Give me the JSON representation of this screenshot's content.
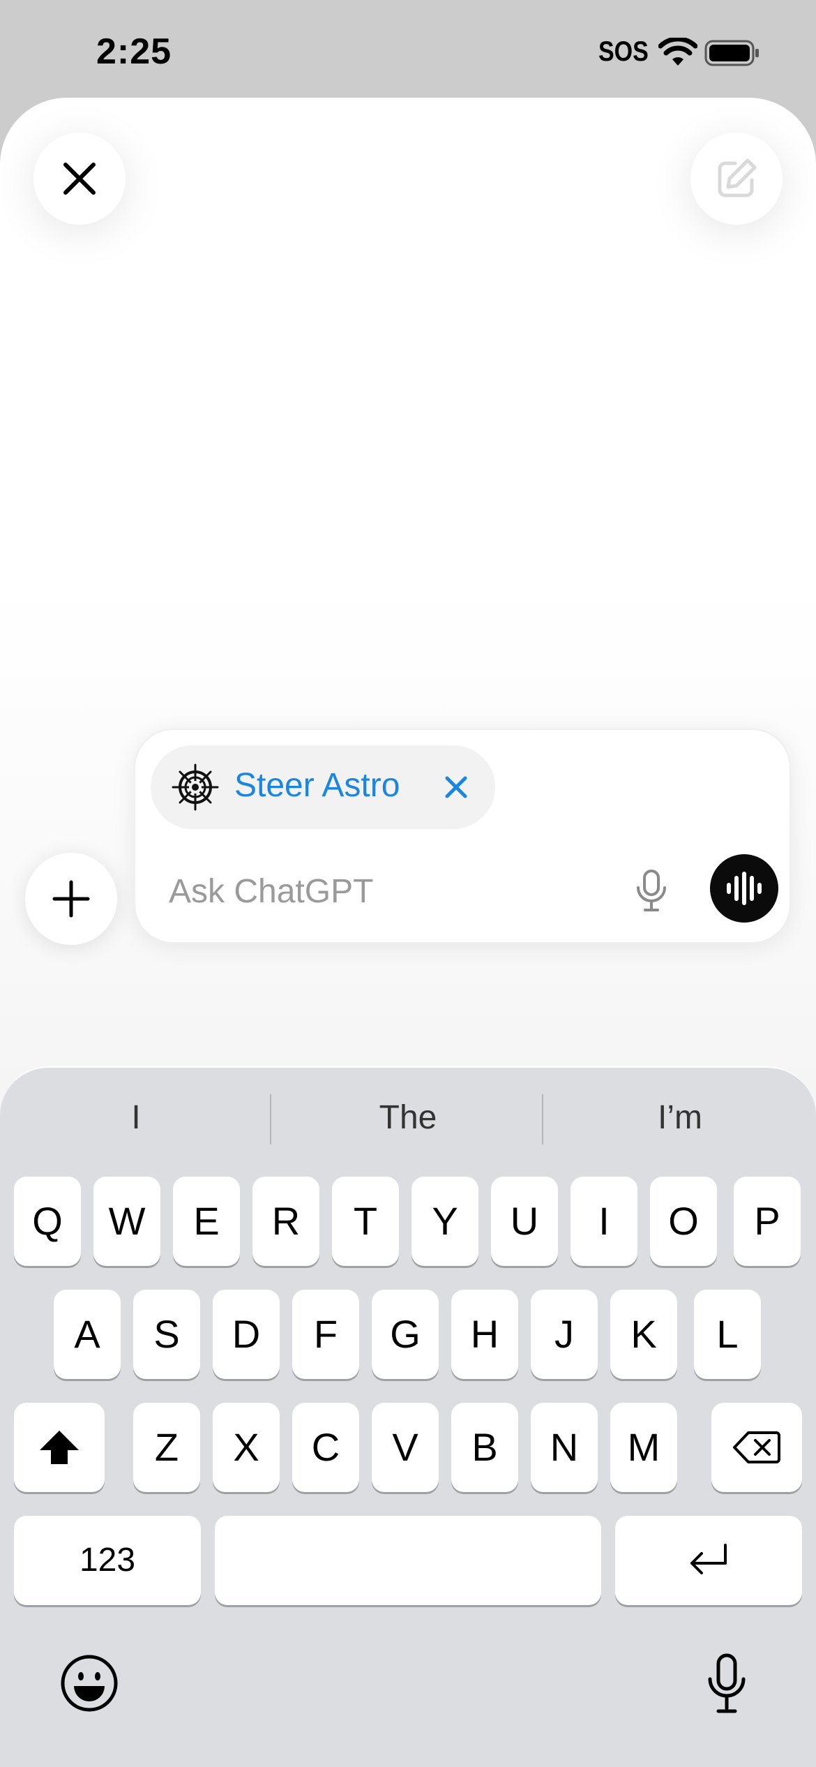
{
  "status_bar": {
    "time": "2:25",
    "sos": "SOS",
    "wifi_icon": "wifi-icon",
    "battery_icon": "battery-icon"
  },
  "header": {
    "close_icon": "close-icon",
    "compose_icon": "compose-icon"
  },
  "composer": {
    "chip": {
      "label": "Steer Astro",
      "icon": "ship-wheel-icon",
      "remove_icon": "close-icon",
      "color": "#1a86e0"
    },
    "placeholder": "Ask ChatGPT",
    "value": "",
    "mic_icon": "microphone-icon",
    "voice_icon": "voice-waveform-icon",
    "plus_icon": "plus-icon"
  },
  "keyboard": {
    "suggestions": [
      "I",
      "The",
      "I’m"
    ],
    "row1": [
      "Q",
      "W",
      "E",
      "R",
      "T",
      "Y",
      "U",
      "I",
      "O",
      "P"
    ],
    "row2": [
      "A",
      "S",
      "D",
      "F",
      "G",
      "H",
      "J",
      "K",
      "L"
    ],
    "row3": [
      "Z",
      "X",
      "C",
      "V",
      "B",
      "N",
      "M"
    ],
    "numbers_label": "123",
    "shift_icon": "shift-icon",
    "backspace_icon": "backspace-icon",
    "return_icon": "return-icon",
    "emoji_icon": "emoji-icon",
    "dictation_icon": "microphone-icon"
  }
}
